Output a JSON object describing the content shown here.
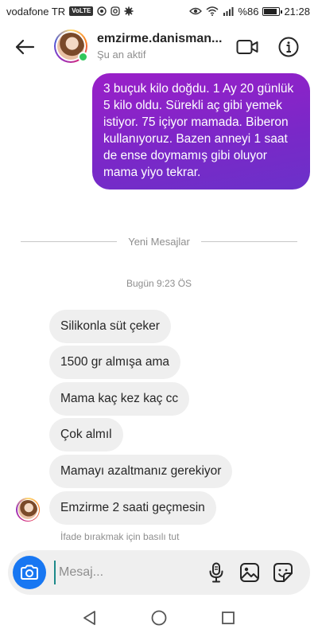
{
  "status_bar": {
    "carrier": "vodafone TR",
    "volte": "VoLTE",
    "battery": "%86",
    "battery_level": 0.86,
    "time": "21:28"
  },
  "header": {
    "username": "emzirme.danisman...",
    "active_status": "Şu an aktif",
    "icons": {
      "back": "back-arrow-icon",
      "video": "video-call-icon",
      "info": "info-icon"
    }
  },
  "messages": {
    "outgoing": {
      "text": "3 buçuk kilo doğdu. 1 Ay 20 günlük 5 kilo oldu. Sürekli aç gibi yemek istiyor. 75 içiyor mamada. Biberon kullanıyoruz. Bazen anneyi 1 saat de ense doymamış gibi oluyor mama yiyo tekrar."
    },
    "divider_label": "Yeni Mesajlar",
    "timestamp": "Bugün 9:23 ÖS",
    "incoming": [
      "Silikonla süt çeker",
      "1500 gr almışa ama",
      "Mama kaç kez kaç cc",
      "Çok almıl",
      "Mamayı azaltmanız gerekiyor",
      "Emzirme 2 saati geçmesin"
    ],
    "reaction_hint": "İfade bırakmak için basılı tut"
  },
  "composer": {
    "placeholder": "Mesaj...",
    "value": "",
    "icons": {
      "camera": "camera-icon",
      "mic": "microphone-icon",
      "gallery": "gallery-icon",
      "sticker": "sticker-icon"
    }
  },
  "colors": {
    "outgoing_bubble": "#8a23c8",
    "incoming_bubble": "#efefef",
    "camera_button": "#1877f2",
    "online": "#31c75b"
  }
}
